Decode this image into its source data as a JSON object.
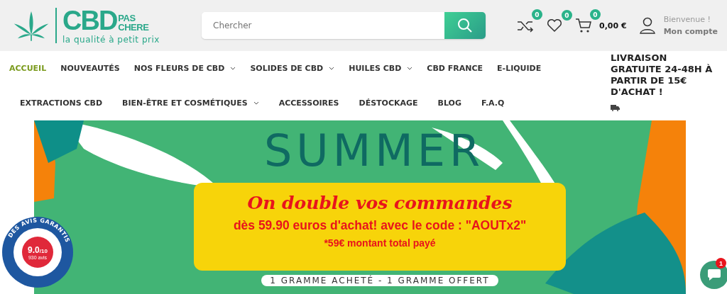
{
  "logo": {
    "name_main": "CBD",
    "name_top": "PAS",
    "name_bottom": "CHERE",
    "tagline": "la qualité à petit prix"
  },
  "search": {
    "placeholder": "Chercher"
  },
  "header_icons": [
    {
      "kind": "compare",
      "count": "0"
    },
    {
      "kind": "wishlist",
      "count": "0"
    },
    {
      "kind": "cart",
      "count": "0",
      "amount": "0,00 €"
    }
  ],
  "account": {
    "greeting": "Bienvenue !",
    "link": "Mon compte"
  },
  "nav_rows": [
    [
      {
        "label": "ACCUEIL",
        "selected": true,
        "dropdown": false
      },
      {
        "label": "NOUVEAUTÉS",
        "selected": false,
        "dropdown": false
      },
      {
        "label": "NOS FLEURS DE CBD",
        "selected": false,
        "dropdown": true
      },
      {
        "label": "SOLIDES DE CBD",
        "selected": false,
        "dropdown": true
      },
      {
        "label": "HUILES CBD",
        "selected": false,
        "dropdown": true
      },
      {
        "label": "CBD FRANCE",
        "selected": false,
        "dropdown": false
      },
      {
        "label": "E-LIQUIDE",
        "selected": false,
        "dropdown": false
      }
    ],
    [
      {
        "label": "EXTRACTIONS CBD",
        "selected": false,
        "dropdown": false
      },
      {
        "label": "BIEN-ÊTRE ET COSMÉTIQUES",
        "selected": false,
        "dropdown": true
      },
      {
        "label": "ACCESSOIRES",
        "selected": false,
        "dropdown": false
      },
      {
        "label": "DÉSTOCKAGE",
        "selected": false,
        "dropdown": false
      },
      {
        "label": "BLOG",
        "selected": false,
        "dropdown": false
      },
      {
        "label": "F.A.Q",
        "selected": false,
        "dropdown": false
      }
    ]
  ],
  "shipping_notice": "LIVRAISON GRATUITE 24-48H À PARTIR DE 15€ D'ACHAT !",
  "banner": {
    "title": "SUMMER",
    "headline": "On double vos commandes",
    "offer": "dès 59.90 euros d'achat! avec le code : \"AOUTx2\"",
    "note": "*59€ montant total payé",
    "pill": "1 GRAMME ACHETÉ - 1 GRAMME OFFERT"
  },
  "review_badge": {
    "ring_text": "DES AVIS GARANTIS",
    "score": "9.0",
    "scale": "/10",
    "count": "930 avis"
  },
  "chat": {
    "unread": "1"
  }
}
